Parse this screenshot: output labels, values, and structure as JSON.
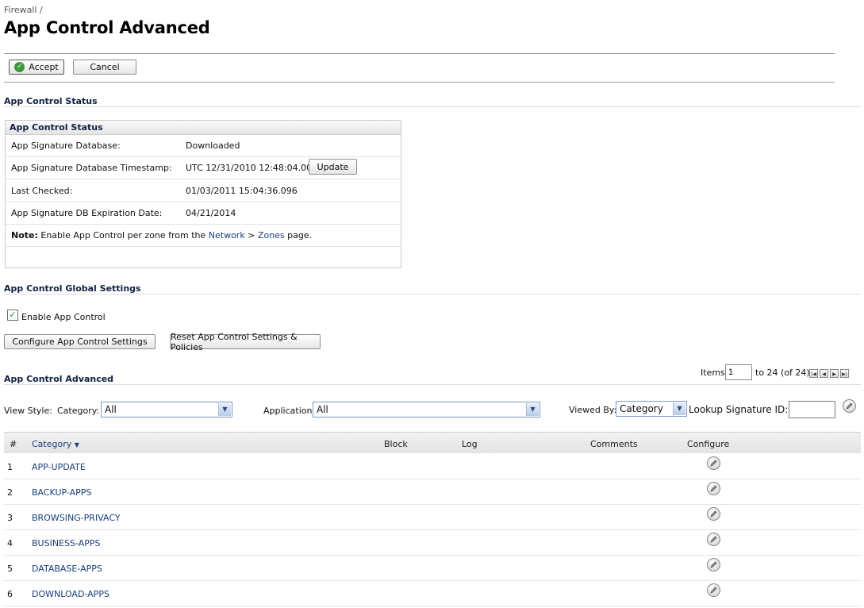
{
  "breadcrumb": "Firewall /",
  "page_title": "App Control Advanced",
  "toolbar": {
    "accept_label": "Accept",
    "cancel_label": "Cancel"
  },
  "status_section": {
    "heading": "App Control Status",
    "box_title": "App Control Status",
    "rows": [
      {
        "label": "App Signature Database:",
        "value": "Downloaded"
      },
      {
        "label": "App Signature Database Timestamp:",
        "value": "UTC 12/31/2010 12:48:04.000"
      },
      {
        "label": "Last Checked:",
        "value": "01/03/2011 15:04:36.096"
      },
      {
        "label": "App Signature DB Expiration Date:",
        "value": "04/21/2014"
      }
    ],
    "update_label": "Update",
    "note_bold": "Note:",
    "note_text": " Enable App Control per zone from the ",
    "note_link1": "Network",
    "note_sep": " > ",
    "note_link2": "Zones",
    "note_end": " page."
  },
  "global_settings": {
    "heading": "App Control Global Settings",
    "enable_label": "Enable App Control",
    "enable_checked": true,
    "configure_btn": "Configure App Control Settings",
    "reset_btn": "Reset App Control Settings & Policies"
  },
  "advanced": {
    "heading": "App Control Advanced",
    "items_label": "Items",
    "items_start": "1",
    "items_range": "to 24 (of 24)",
    "view_style_label": "View Style:",
    "category_label": "Category:",
    "category_value": "All",
    "application_label": "Application:",
    "application_value": "All",
    "viewed_by_label": "Viewed By:",
    "viewed_by_value": "Category",
    "lookup_label": "Lookup Signature ID:"
  },
  "table": {
    "headers": {
      "num": "#",
      "category": "Category",
      "block": "Block",
      "log": "Log",
      "comments": "Comments",
      "configure": "Configure"
    },
    "rows": [
      {
        "num": "1",
        "category": "APP-UPDATE"
      },
      {
        "num": "2",
        "category": "BACKUP-APPS"
      },
      {
        "num": "3",
        "category": "BROWSING-PRIVACY"
      },
      {
        "num": "4",
        "category": "BUSINESS-APPS"
      },
      {
        "num": "5",
        "category": "DATABASE-APPS"
      },
      {
        "num": "6",
        "category": "DOWNLOAD-APPS"
      }
    ]
  },
  "icons": {
    "accept": "check-circle-icon",
    "edit": "pencil-icon",
    "dropdown": "chevron-down-icon",
    "sort": "sort-down-icon",
    "pager": [
      "first-page-icon",
      "prev-page-icon",
      "next-page-icon",
      "last-page-icon"
    ]
  }
}
